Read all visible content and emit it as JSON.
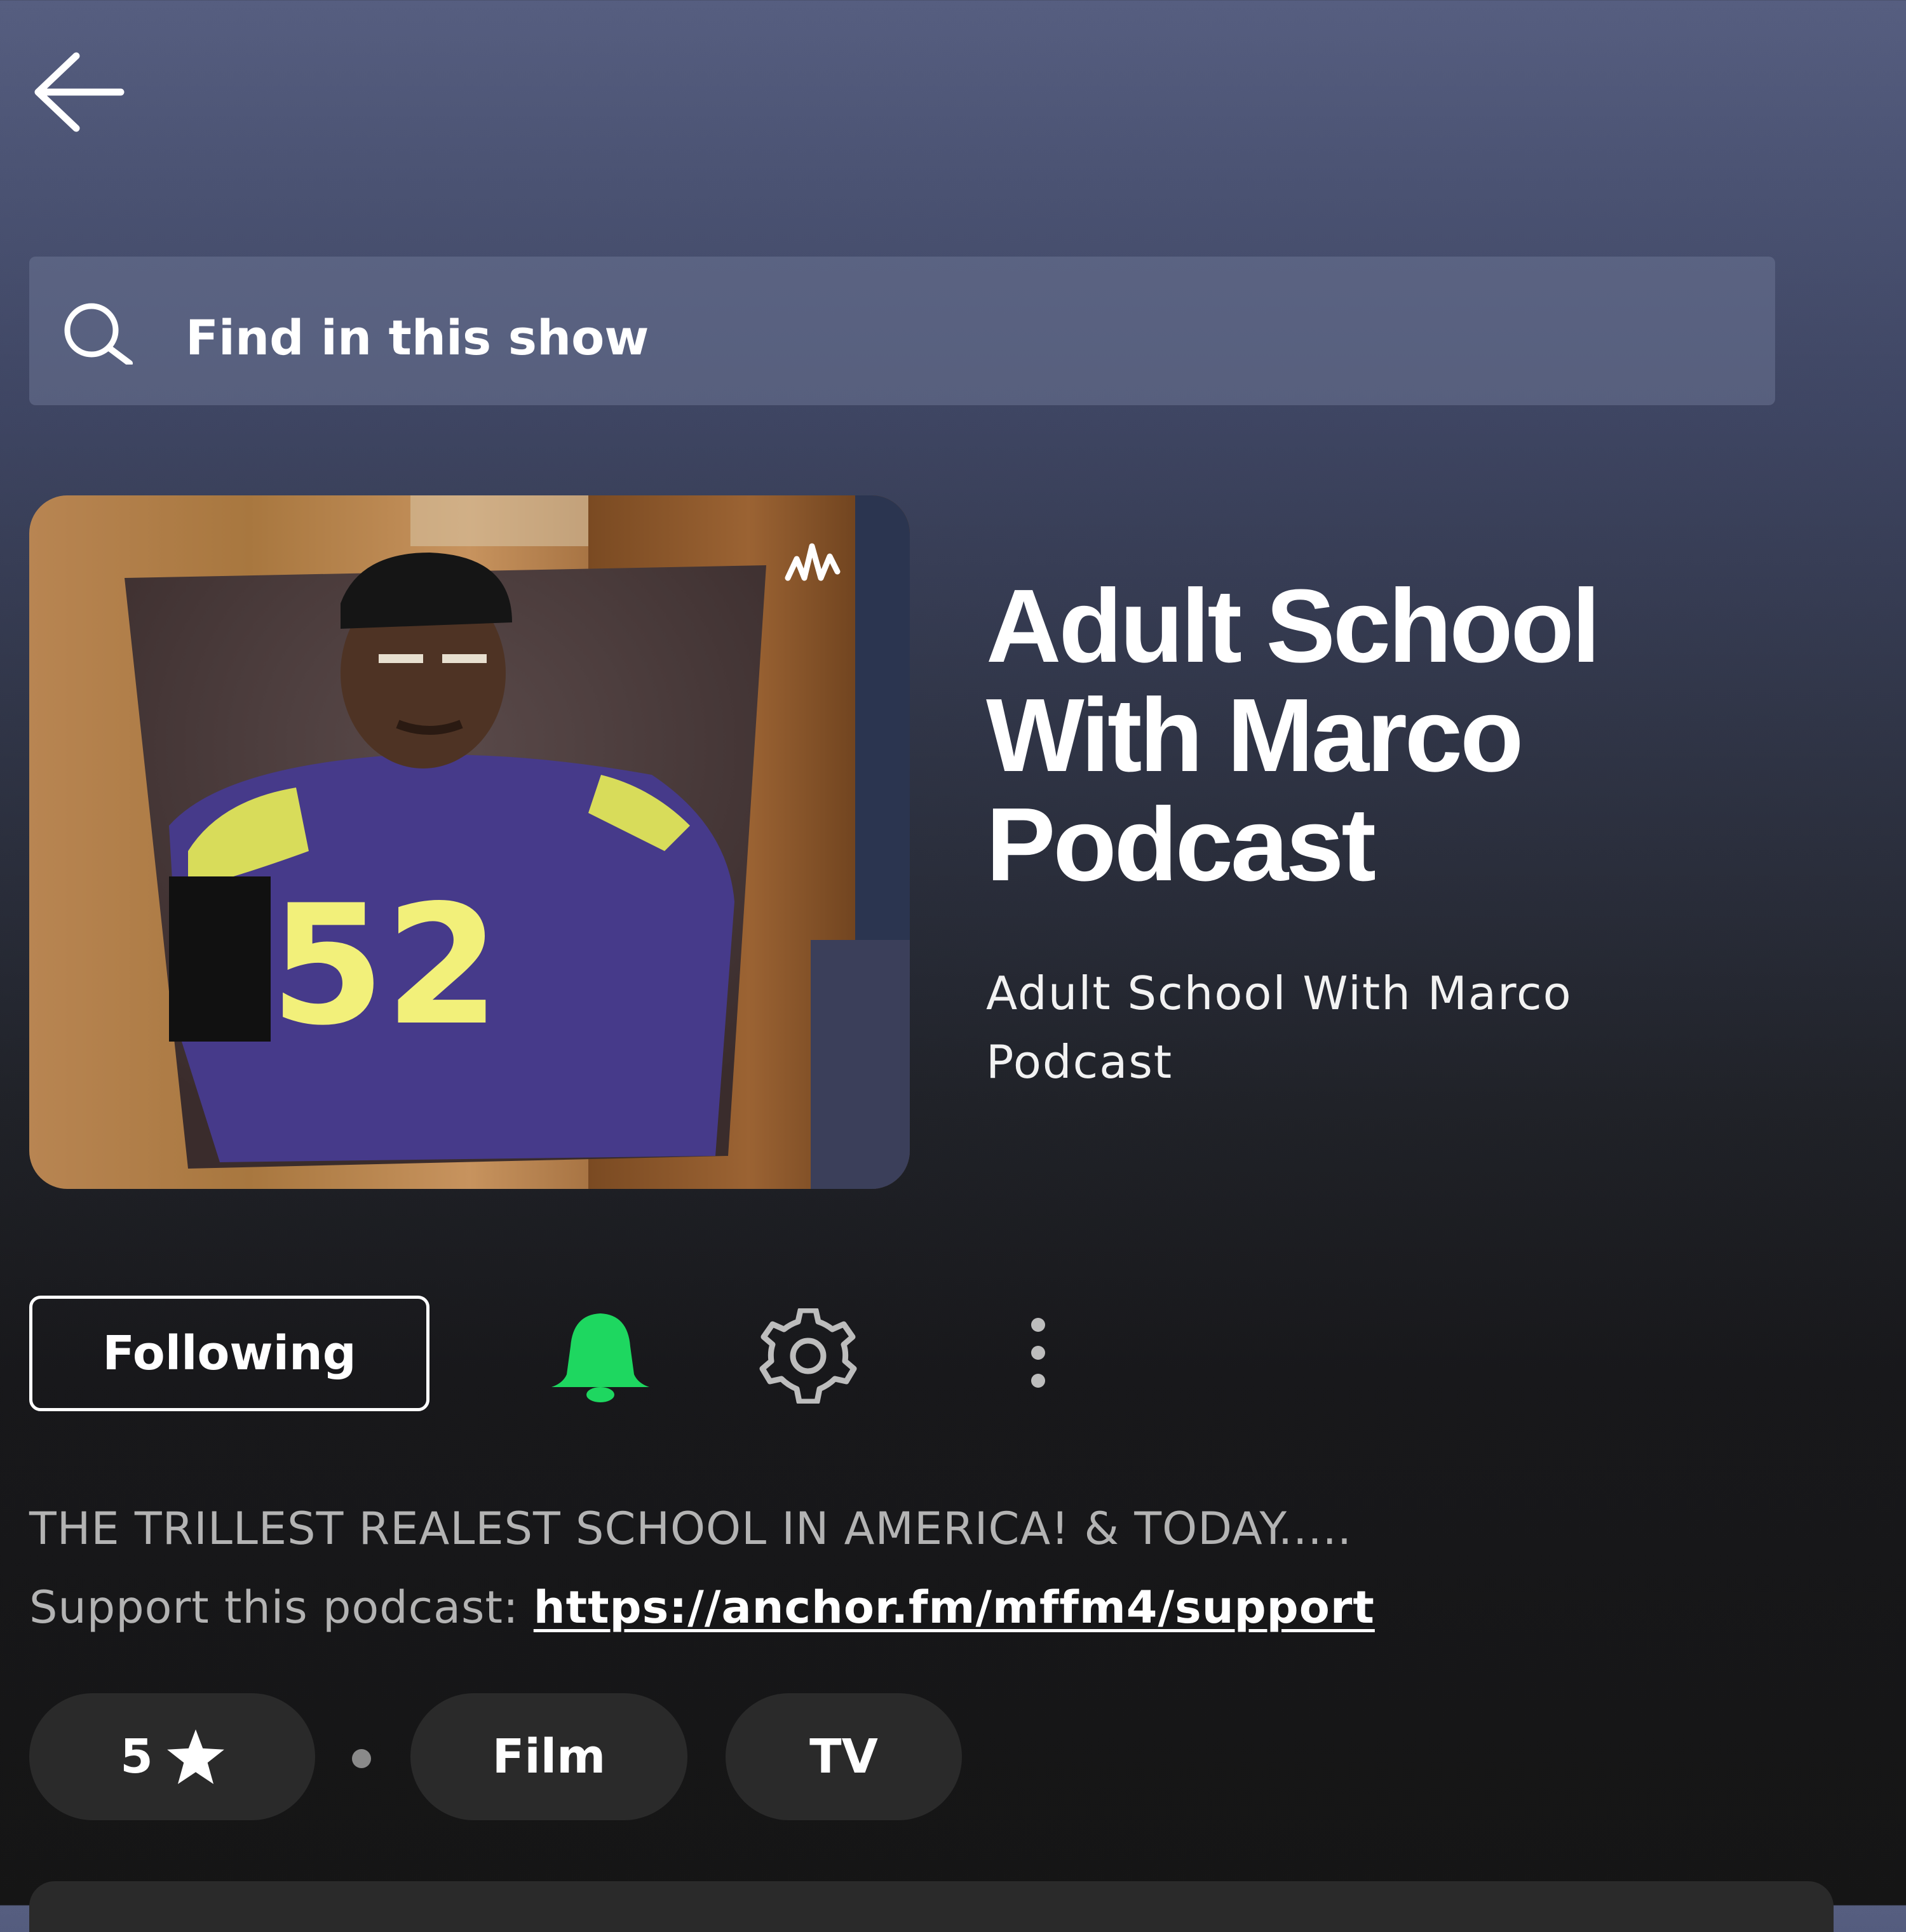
{
  "header": {
    "back_icon": "arrow-left-icon"
  },
  "search": {
    "placeholder": "Find in this show",
    "icon": "search-icon"
  },
  "show": {
    "title": "Adult School\nWith Marco\nPodcast",
    "publisher": "Adult School With Marco Podcast",
    "cover_badge_icon": "anchor-logo-icon"
  },
  "actions": {
    "follow_label": "Following",
    "bell_icon": "bell-icon",
    "settings_icon": "gear-icon",
    "more_icon": "more-vertical-icon",
    "accent_color": "#1ed760"
  },
  "description": {
    "text": "THE TRILLEST REALEST SCHOOL IN AMERICA! & TODAY.....",
    "support_prefix": "Support this podcast: ",
    "support_link": "https://anchor.fm/mffm4/support"
  },
  "chips": {
    "rating": "5",
    "rating_icon": "star-icon",
    "separator": "•",
    "categories": [
      "Film",
      "TV"
    ]
  }
}
